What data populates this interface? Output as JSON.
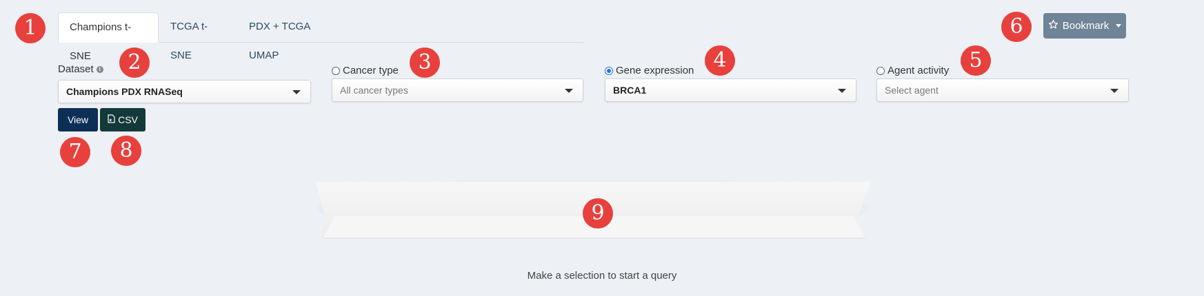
{
  "tabs": [
    {
      "label": "Champions t-SNE",
      "active": true
    },
    {
      "label": "TCGA t-SNE",
      "active": false
    },
    {
      "label": "PDX + TCGA UMAP",
      "active": false
    }
  ],
  "bookmark": {
    "label": "Bookmark",
    "icon": "star-icon"
  },
  "dataset": {
    "label": "Dataset",
    "value": "Champions PDX RNASeq",
    "info_icon": "info-icon"
  },
  "cancer_type": {
    "label": "Cancer type",
    "checked": false,
    "placeholder": "All cancer types"
  },
  "gene_expression": {
    "label": "Gene expression",
    "checked": true,
    "value": "BRCA1"
  },
  "agent_activity": {
    "label": "Agent activity",
    "checked": false,
    "placeholder": "Select agent"
  },
  "actions": {
    "view_label": "View",
    "csv_label": "CSV",
    "csv_icon": "file-csv-icon"
  },
  "badges": [
    "1",
    "2",
    "3",
    "4",
    "5",
    "6",
    "7",
    "8",
    "9"
  ],
  "hint": "Make a selection to start a query",
  "colors": {
    "view_button": "#0d2f57",
    "csv_button": "#13393a",
    "bookmark_button": "#6f8496",
    "badge": "#e8403c",
    "radio_checked": "#1a73e8"
  }
}
